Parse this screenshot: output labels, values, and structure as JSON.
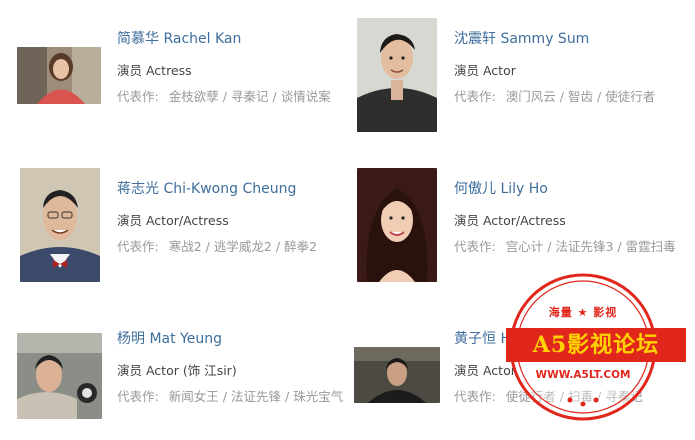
{
  "cast": [
    {
      "name": "简慕华 Rachel Kan",
      "role": "演员 Actress",
      "works_label": "代表作:",
      "works": [
        "金枝欲孽",
        "寻秦记",
        "谈情说案"
      ]
    },
    {
      "name": "沈震轩 Sammy Sum",
      "role": "演员 Actor",
      "works_label": "代表作:",
      "works": [
        "澳门风云",
        "智齿",
        "使徒行者"
      ]
    },
    {
      "name": "蒋志光 Chi-Kwong Cheung",
      "role": "演员 Actor/Actress",
      "works_label": "代表作:",
      "works": [
        "寒战2",
        "逃学威龙2",
        "醉拳2"
      ]
    },
    {
      "name": "何傲儿 Lily Ho",
      "role": "演员 Actor/Actress",
      "works_label": "代表作:",
      "works": [
        "宫心计",
        "法证先锋3",
        "雷霆扫毒"
      ]
    },
    {
      "name": "杨明 Mat Yeung",
      "role": "演员 Actor (饰 江sir)",
      "works_label": "代表作:",
      "works": [
        "新闻女王",
        "法证先锋",
        "珠光宝气"
      ]
    },
    {
      "name": "黄子恒 Hugo Wong",
      "role": "演员 Actor",
      "works_label": "代表作:",
      "works": [
        "使徒行者",
        "扫毒",
        "寻秦记"
      ]
    }
  ],
  "watermark": {
    "top_text": "海量 ★ 影视",
    "main_text": "A5影视论坛",
    "url_text": "WWW.A5LT.COM",
    "color": "#e1261c",
    "accent": "#ffd200"
  }
}
